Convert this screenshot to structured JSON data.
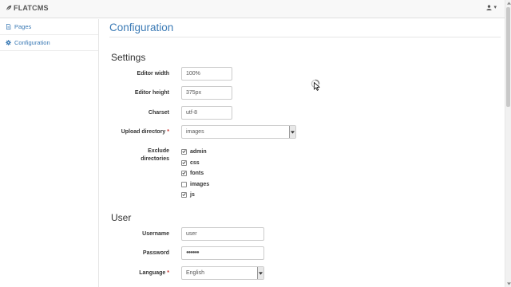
{
  "brand": {
    "name": "FLATCMS"
  },
  "header": {
    "user_icon": "user-icon",
    "caret": "▾"
  },
  "sidebar": {
    "items": [
      {
        "label": "Pages",
        "icon": "file-icon"
      },
      {
        "label": "Configuration",
        "icon": "gear-icon"
      }
    ]
  },
  "main": {
    "title": "Configuration"
  },
  "settings": {
    "title": "Settings",
    "editor_width": {
      "label": "Editor width",
      "value": "100%"
    },
    "editor_height": {
      "label": "Editor height",
      "value": "375px"
    },
    "charset": {
      "label": "Charset",
      "value": "utf-8"
    },
    "upload_directory": {
      "label": "Upload directory",
      "required": "*",
      "value": "images"
    },
    "exclude_directories": {
      "label_line1": "Exclude",
      "label_line2": "directories",
      "options": [
        {
          "label": "admin",
          "checked": true
        },
        {
          "label": "css",
          "checked": true
        },
        {
          "label": "fonts",
          "checked": true
        },
        {
          "label": "images",
          "checked": false
        },
        {
          "label": "js",
          "checked": true
        }
      ]
    }
  },
  "user": {
    "title": "User",
    "username": {
      "label": "Username",
      "value": "user"
    },
    "password": {
      "label": "Password",
      "value": "●●●●●●"
    },
    "language": {
      "label": "Language",
      "required": "*",
      "value": "English"
    }
  },
  "colors": {
    "accent": "#3b7ab5",
    "required": "#c9302c"
  }
}
